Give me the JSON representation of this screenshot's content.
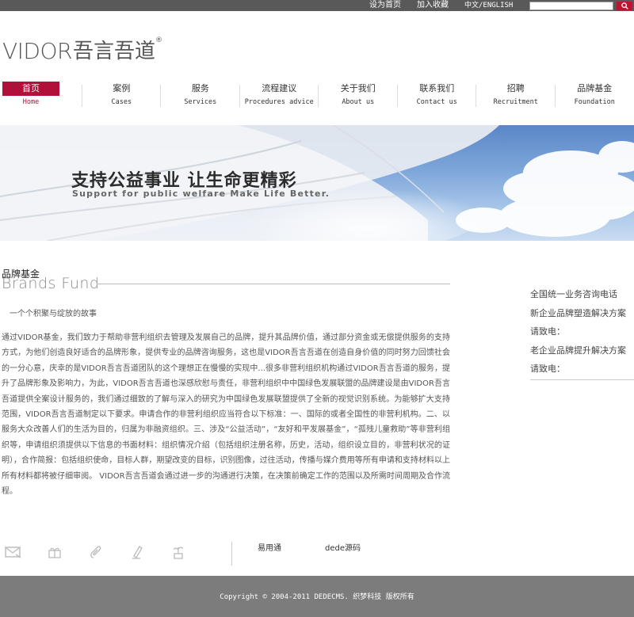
{
  "topbar": {
    "links": [
      "设为首页",
      "加入收藏",
      "中文/ENGLISH"
    ],
    "search_placeholder": ""
  },
  "logo": {
    "latin": "VIDOR",
    "cjk": "吾言吾道",
    "mark": "®"
  },
  "nav": [
    {
      "zh": "首页",
      "en": "Home",
      "active": true
    },
    {
      "zh": "案例",
      "en": "Cases"
    },
    {
      "zh": "服务",
      "en": "Services"
    },
    {
      "zh": "流程建议",
      "en": "Procedures advice"
    },
    {
      "zh": "关于我们",
      "en": "About us"
    },
    {
      "zh": "联系我们",
      "en": "Contact us"
    },
    {
      "zh": "招聘",
      "en": "Recruitment"
    },
    {
      "zh": "品牌基金",
      "en": "Foundation"
    }
  ],
  "banner": {
    "title": "支持公益事业 让生命更精彩",
    "subtitle": "Support for public welfare Make Life Better."
  },
  "section": {
    "title": "品牌基金",
    "title_en": "Brands Fund",
    "tagline": "一个个积聚与绽放的故事",
    "body": "通过VIDOR基金，我们致力于帮助非营利组织去管理及发展自己的品牌，提升其品牌价值，通过部分资金或无偿提供服务的支持方式，为他们创造良好适合的品牌形象，提供专业的品牌咨询服务，这也是VIDOR吾言吾道在创造自身价值的同时努力回馈社会的一分心意，庆幸的是VIDOR吾言吾道团队的这个理想正在慢慢的实现中...很多非营利组织机构通过VIDOR吾言吾道的服务，提升了品牌形象及影响力，为此，VIDOR吾言吾道也深感欣慰与责任，非营利组织中中国绿色发展联盟的品牌建设是由VIDOR吾言吾道提供全案设计服务的，我们通过细致的了解与深入的研究为中国绿色发展联盟提供了全新的视觉识别系统。为能够扩大支持范围，VIDOR吾言吾道制定以下要求。申请合作的非营利组织应当符合以下标准：一、国际的或者全国性的非营利机构。二、以服务大众改善人们的生活为目的，归属为非融资组织。三、涉及“公益活动”，“友好和平发展基金”，“孤残儿童救助”等非营利组织等，申请组织须提供以下信息的书面材料：组织情况介绍（包括组织注册名称，历史，活动，组织设立目的，非营利状况的证明），合作简报：包括组织使命，目标人群，期望改变的目标，识别图像，过往活动，传播与媒介费用等所有申请和支持材料以上所有材料都将被仔细审阅。 VIDOR吾言吾道会通过进一步的沟通进行决策，在决策前确定工作的范围以及所需时间周期及合作流程。"
  },
  "sidebar": {
    "rows": [
      "全国统一业务咨询电话",
      "新企业品牌塑造解决方案",
      "请致电：",
      "老企业品牌提升解决方案",
      "请致电："
    ]
  },
  "footer_links": [
    "易用通",
    "dede源码"
  ],
  "footer": {
    "copyright": "Copyright © 2004-2011 DEDECMS. 织梦科技 版权所有"
  },
  "colors": {
    "accent": "#b0103a",
    "topbar": "#595959",
    "footer": "#7c7c7c"
  }
}
